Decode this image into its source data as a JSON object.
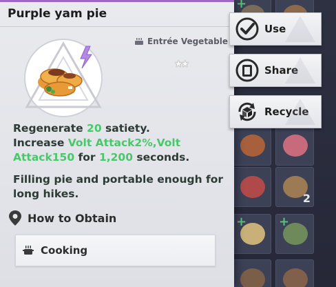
{
  "item": {
    "name": "Purple yam pie",
    "category": "Entrée Vegetable",
    "rarity_stars": "★★",
    "effect_line1": {
      "prefix": "Regenerate ",
      "value": "20",
      "suffix": " satiety."
    },
    "effect_line2": {
      "prefix": "Increase ",
      "value": "Volt Attack2%,Volt Attack150",
      "mid": " for ",
      "duration": "1,200",
      "suffix": " seconds."
    },
    "flavor": "Filling pie and portable enough for long hikes."
  },
  "obtain": {
    "heading": "How to Obtain",
    "sources": [
      {
        "label": "Cooking",
        "icon": "cooking-pot-icon"
      }
    ]
  },
  "actions": [
    {
      "label": "Use",
      "icon": "check-icon"
    },
    {
      "label": "Share",
      "icon": "share-icon"
    },
    {
      "label": "Recycle",
      "icon": "recycle-icon"
    }
  ],
  "inventory": {
    "visible_quantity": "2"
  },
  "colors": {
    "accent_green": "#47c96a",
    "title_bar_purple": "#9f66c9",
    "panel_bg": "#e6e7ec"
  }
}
